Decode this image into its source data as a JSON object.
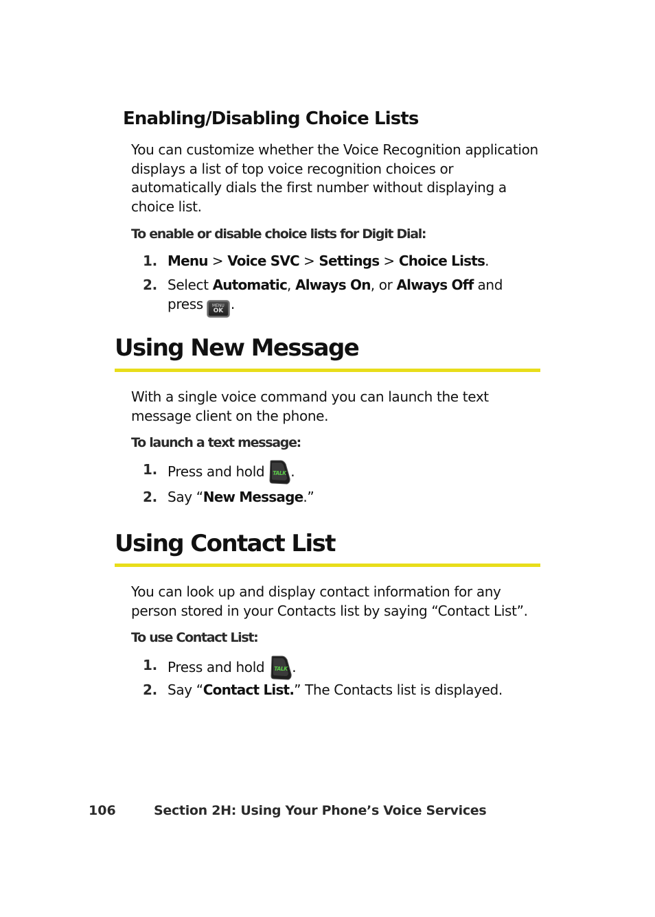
{
  "section_choice": {
    "heading": "Enabling/Disabling Choice Lists",
    "body_lines": [
      "You can customize whether the Voice Recognition application",
      "displays a list of top voice recognition choices or",
      "automatically dials the first number without displaying a",
      "choice list."
    ],
    "procedure_title": "To enable or disable choice lists for Digit Dial:",
    "steps": [
      {
        "num": "1.",
        "path": [
          "Menu",
          "Voice SVC",
          "Settings",
          "Choice Lists"
        ],
        "separator": ">",
        "end": "."
      },
      {
        "num": "2.",
        "prefix": "Select ",
        "options": [
          "Automatic",
          "Always On",
          "Always Off"
        ],
        "comma": ", ",
        "or": ", or ",
        "suffix": " and",
        "line2_prefix": "press",
        "key_icon": "menu-ok-key-icon",
        "key_label_top": "MENU",
        "key_label_bottom": "OK",
        "end": "."
      }
    ]
  },
  "section_new_message": {
    "heading": "Using New Message",
    "body_lines": [
      "With a single voice command you can launch the text",
      "message client on the phone."
    ],
    "procedure_title": "To launch a text message:",
    "steps": [
      {
        "num": "1.",
        "text": "Press and hold",
        "key_icon": "talk-key-icon",
        "key_label": "TALK",
        "end": "."
      },
      {
        "num": "2.",
        "prefix": "Say “",
        "bold": "New Message",
        "suffix": ".”"
      }
    ]
  },
  "section_contact_list": {
    "heading": "Using Contact List",
    "body_lines": [
      "You can look up and display contact information for any",
      "person stored in your Contacts list by saying “Contact List”."
    ],
    "procedure_title": "To use Contact List:",
    "steps": [
      {
        "num": "1.",
        "text": "Press and hold",
        "key_icon": "talk-key-icon",
        "key_label": "TALK",
        "end": "."
      },
      {
        "num": "2.",
        "prefix": "Say “",
        "bold": "Contact List.",
        "suffix": "” The Contacts list is displayed."
      }
    ]
  },
  "footer": {
    "page_number": "106",
    "section_title": "Section 2H: Using Your Phone’s Voice Services"
  },
  "colors": {
    "heading_rule": "#E8DD1A",
    "talk_key_label": "#5CCB4A",
    "text": "#111111"
  }
}
